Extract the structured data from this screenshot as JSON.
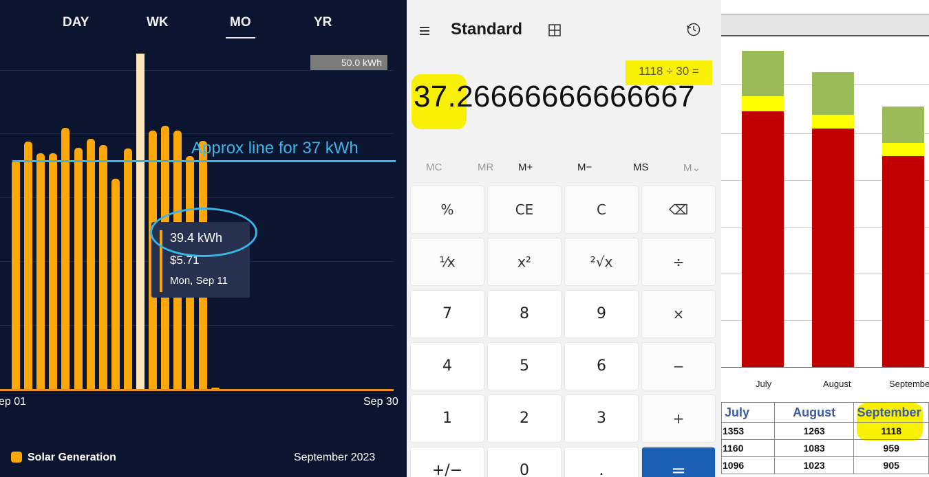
{
  "solar_app": {
    "period_tabs": [
      "DAY",
      "WK",
      "MO",
      "YR"
    ],
    "active_tab": "MO",
    "max_value_label": "50.0 kWh",
    "annotation_text": "Approx line for 37 kWh",
    "tooltip": {
      "energy": "39.4 kWh",
      "cost": "$5.71",
      "date": "Mon, Sep 11"
    },
    "x_axis_start": "ep 01",
    "x_axis_end": "Sep 30",
    "legend_label": "Solar Generation",
    "month_label": "September 2023",
    "accent_color": "#fca80a",
    "annotation_color": "#38b6e8",
    "background_color": "#0c1530"
  },
  "chart_data": {
    "type": "bar",
    "ylim": [
      0,
      50
    ],
    "selected_day": 11,
    "reference_line": 37,
    "days": [
      "01",
      "02",
      "03",
      "04",
      "05",
      "06",
      "07",
      "08",
      "09",
      "10",
      "11",
      "12",
      "13",
      "14",
      "15",
      "16",
      "17",
      "18",
      "19",
      "20",
      "21",
      "22",
      "23",
      "24",
      "25",
      "26",
      "27",
      "28",
      "29",
      "30"
    ],
    "values": [
      35.1,
      38.0,
      36.2,
      36.2,
      40.1,
      37.0,
      38.4,
      37.5,
      32.3,
      36.9,
      39.4,
      39.7,
      40.4,
      39.7,
      35.8,
      38.1,
      0.2,
      0,
      0,
      0,
      0,
      0,
      0,
      0,
      0,
      0,
      0,
      0,
      0,
      0
    ]
  },
  "calculator": {
    "title": "Standard",
    "expression": "1118 ÷ 30 =",
    "result": "37.26666666666667",
    "memory_buttons": [
      "MC",
      "MR",
      "M+",
      "M−",
      "MS",
      "M⌄"
    ],
    "keys": [
      [
        "%",
        "CE",
        "C",
        "⌫"
      ],
      [
        "¹⁄x",
        "x²",
        "²√x",
        "÷"
      ],
      [
        "7",
        "8",
        "9",
        "×"
      ],
      [
        "4",
        "5",
        "6",
        "−"
      ],
      [
        "1",
        "2",
        "3",
        "+"
      ],
      [
        "+/−",
        "0",
        ".",
        "="
      ]
    ],
    "highlight_color": "#f8f007",
    "equals_color": "#1a5fb4"
  },
  "excel": {
    "months": [
      "July",
      "August",
      "September"
    ],
    "table": {
      "headers": [
        "July",
        "August",
        "September"
      ],
      "rows": [
        [
          "1353",
          "1263",
          "1118"
        ],
        [
          "1160",
          "1083",
          "959"
        ],
        [
          "1096",
          "1023",
          "905"
        ]
      ]
    },
    "segment_colors": [
      "#c00000",
      "#ffff00",
      "#9bbb59"
    ]
  }
}
